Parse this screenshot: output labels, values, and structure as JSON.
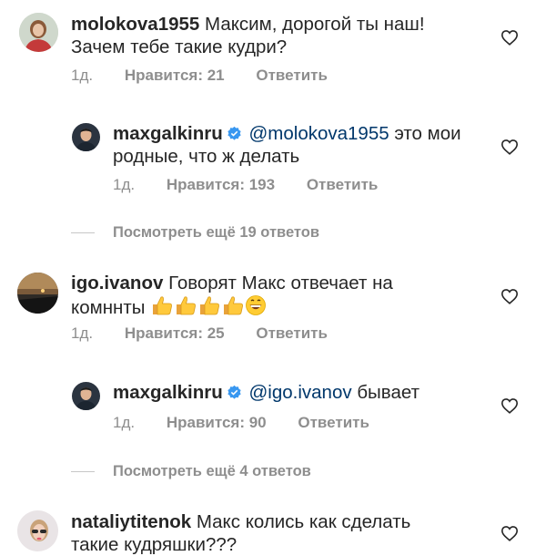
{
  "comments": [
    {
      "username": "molokova1955",
      "text_line1": "Максим, дорогой ты наш!",
      "text_line2": "Зачем тебе такие кудри?",
      "time": "1д.",
      "likes": "Нравится: 21",
      "reply": "Ответить",
      "replies": [
        {
          "username": "maxgalkinru",
          "mention": "@molokova1955",
          "text_line1": "это мои",
          "text_line2": "родные, что ж делать",
          "time": "1д.",
          "likes": "Нравится: 193",
          "reply": "Ответить"
        }
      ],
      "view_more": "Посмотреть ещё 19 ответов"
    },
    {
      "username": "igo.ivanov",
      "text_line1": "Говорят Макс отвечает на",
      "text_line2": "комннты",
      "emojis": [
        "thumbs-up",
        "thumbs-up",
        "thumbs-up",
        "thumbs-up",
        "grinning-face"
      ],
      "time": "1д.",
      "likes": "Нравится: 25",
      "reply": "Ответить",
      "replies": [
        {
          "username": "maxgalkinru",
          "mention": "@igo.ivanov",
          "text_line1": "бывает",
          "time": "1д.",
          "likes": "Нравится: 90",
          "reply": "Ответить"
        }
      ],
      "view_more": "Посмотреть ещё 4 ответов"
    },
    {
      "username": "nataliytitenok",
      "text_line1": "Макс колись как сделать",
      "text_line2": "такие кудряшки???"
    }
  ],
  "icons": {
    "like": "heart-outline-icon",
    "verified": "verified-badge-icon"
  },
  "colors": {
    "text": "#262626",
    "meta": "#8e8e8e",
    "mention": "#00376b",
    "verified": "#3897f0"
  }
}
